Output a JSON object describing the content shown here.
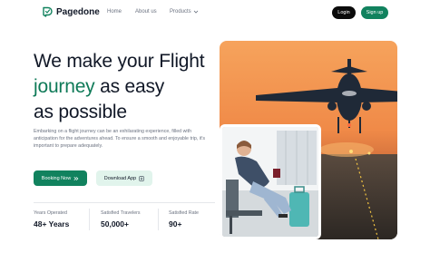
{
  "nav": {
    "brand": "Pagedone",
    "links": [
      "Home",
      "About us",
      "Products"
    ],
    "login_label": "Login",
    "signup_label": "Sign up"
  },
  "hero": {
    "headline_line1": "We make your Flight",
    "headline_accent": "journey",
    "headline_line2_rest": " as easy",
    "headline_line3": "as possible",
    "description": "Embarking on a flight journey can be an exhilarating experience, filled with anticipation for the adventures ahead. To ensure a smooth and enjoyable trip, it's important to prepare adequately.",
    "book_label": "Booking Now",
    "download_label": "Download App"
  },
  "stats": [
    {
      "label": "Years Operated",
      "value": "48+ Years"
    },
    {
      "label": "Satisfied Travelers",
      "value": "50,000+"
    },
    {
      "label": "Satisfied Rate",
      "value": "90+"
    }
  ],
  "icons": {
    "logo": "pagedone-logo-icon",
    "products_chevron": "chevron-down-icon",
    "book_arrow": "double-chevron-right-icon",
    "download": "download-icon"
  },
  "colors": {
    "accent": "#11825e",
    "accent_light": "#e1f4ec",
    "text_dark": "#111827",
    "text_muted": "#6b7280",
    "login_bg": "#0b0b0b"
  }
}
